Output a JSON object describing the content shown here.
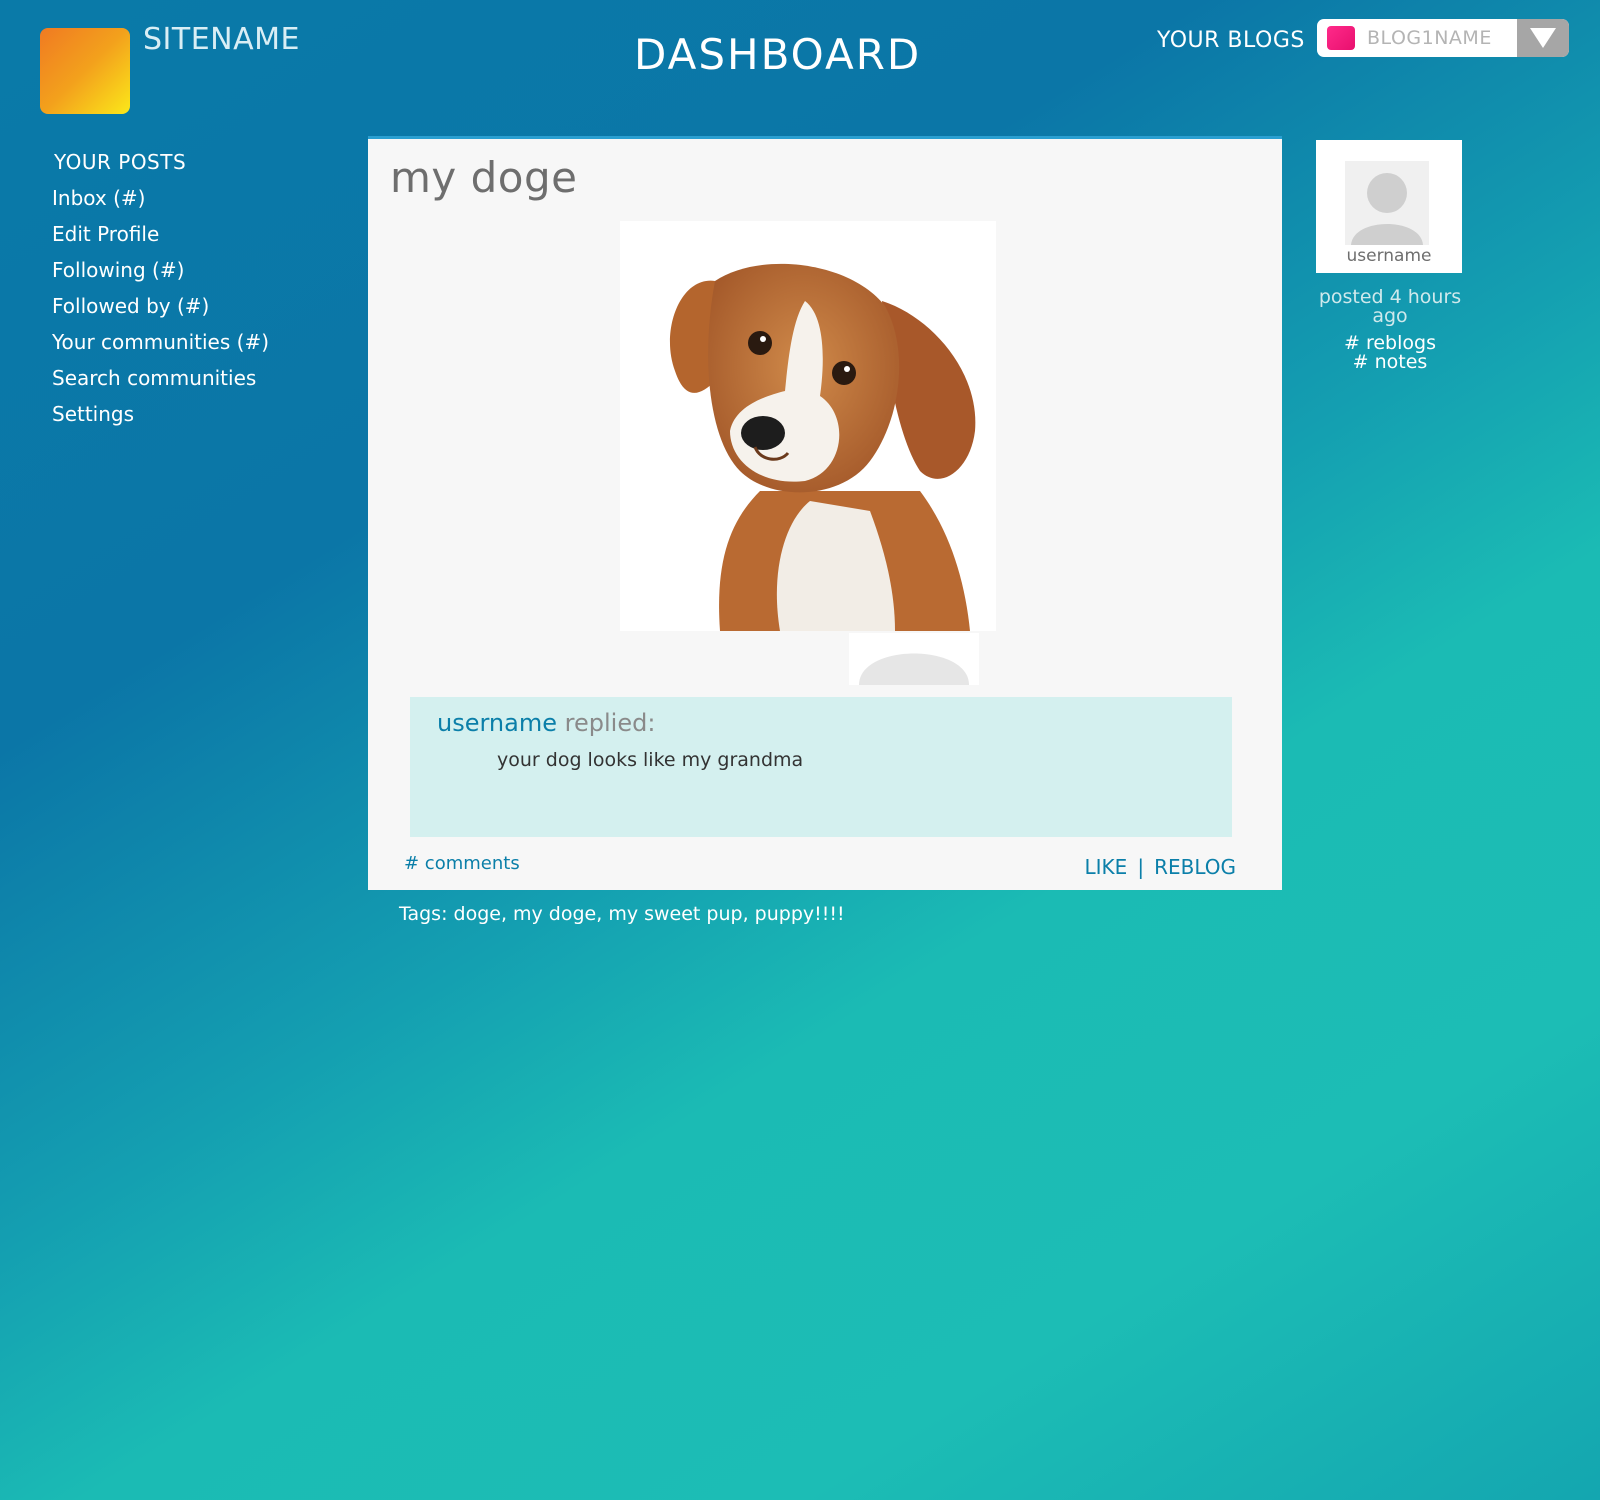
{
  "header": {
    "site_name": "SITENAME",
    "page_title": "DASHBOARD",
    "your_blogs_label": "YOUR BLOGS",
    "blog_selector": {
      "selected": "BLOG1NAME",
      "swatch_color": "#f0157a"
    }
  },
  "sidebar": {
    "heading": "YOUR POSTS",
    "items": [
      {
        "label": "Inbox (#)"
      },
      {
        "label": "Edit Profile"
      },
      {
        "label": "Following (#)"
      },
      {
        "label": "Followed by (#)"
      },
      {
        "label": "Your communities (#)"
      },
      {
        "label": "Search communities"
      },
      {
        "label": "Settings"
      }
    ]
  },
  "post": {
    "title": "my doge",
    "image_icon": "dog-photo",
    "reply": {
      "username": "username",
      "verb": "replied:",
      "text": "your dog looks like my grandma"
    },
    "comments_label": "# comments",
    "like_label": "LIKE",
    "separator": "|",
    "reblog_label": "REBLOG",
    "tags": "Tags: doge, my doge, my sweet pup, puppy!!!!"
  },
  "author": {
    "username": "username",
    "posted": "posted 4 hours ago",
    "reblogs": "# reblogs",
    "notes": "# notes"
  },
  "colors": {
    "accent": "#0b7fa9",
    "reply_background": "#d4f0ef",
    "logo_gradient_start": "#f07a22",
    "logo_gradient_end": "#fbe81a"
  }
}
